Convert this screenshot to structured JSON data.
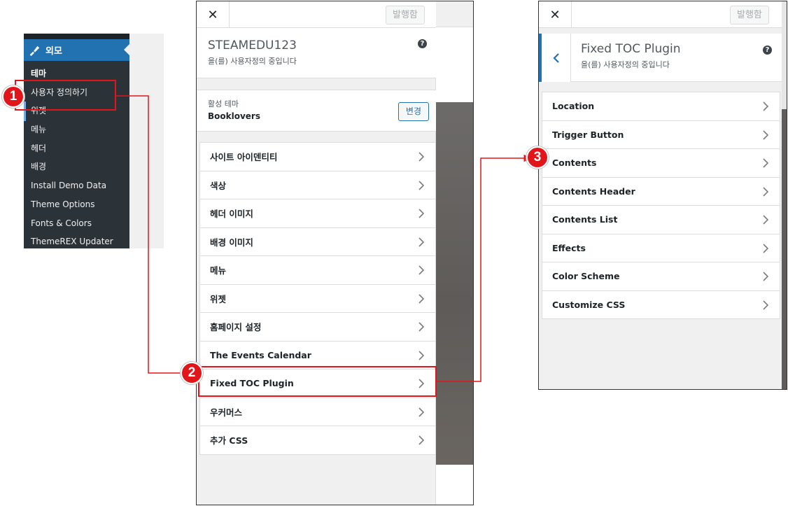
{
  "admin_menu": {
    "header_label": "외모",
    "header_icon": "paintbrush-icon",
    "items": [
      {
        "label": "테마",
        "current": true
      },
      {
        "label": "사용자 정의하기",
        "current": false
      },
      {
        "label": "위젯",
        "current": false
      },
      {
        "label": "메뉴",
        "current": false
      },
      {
        "label": "헤더",
        "current": false
      },
      {
        "label": "배경",
        "current": false
      },
      {
        "label": "Install Demo Data",
        "current": false
      },
      {
        "label": "Theme Options",
        "current": false
      },
      {
        "label": "Fonts & Colors",
        "current": false
      },
      {
        "label": "ThemeREX Updater",
        "current": false
      }
    ]
  },
  "customizer_main": {
    "close_glyph": "✕",
    "publish_label": "발행함",
    "site_title": "STEAMEDU123",
    "site_subtitle": "을(를) 사용자정의 중입니다",
    "help_glyph": "?",
    "active_theme_label": "활성 테마",
    "active_theme_name": "Booklovers",
    "change_label": "변경",
    "sections": [
      "사이트 아이덴티티",
      "색상",
      "헤더 이미지",
      "배경 이미지",
      "메뉴",
      "위젯",
      "홈페이지 설정",
      "The Events Calendar",
      "Fixed TOC Plugin",
      "우커머스",
      "추가 CSS"
    ]
  },
  "toc_panel": {
    "close_glyph": "✕",
    "publish_label": "발행함",
    "title": "Fixed TOC Plugin",
    "subtitle": "을(를) 사용자정의 중입니다",
    "help_glyph": "?",
    "back_icon": "chevron-left-icon",
    "sections": [
      "Location",
      "Trigger Button",
      "Contents",
      "Contents Header",
      "Contents List",
      "Effects",
      "Color Scheme",
      "Customize CSS"
    ]
  },
  "annotations": {
    "step1": "1",
    "step2": "2",
    "step3": "3",
    "color": "#e0161b"
  },
  "colors": {
    "admin_dark": "#2c3338",
    "admin_accent": "#2271b1",
    "border": "#dcdcde"
  }
}
